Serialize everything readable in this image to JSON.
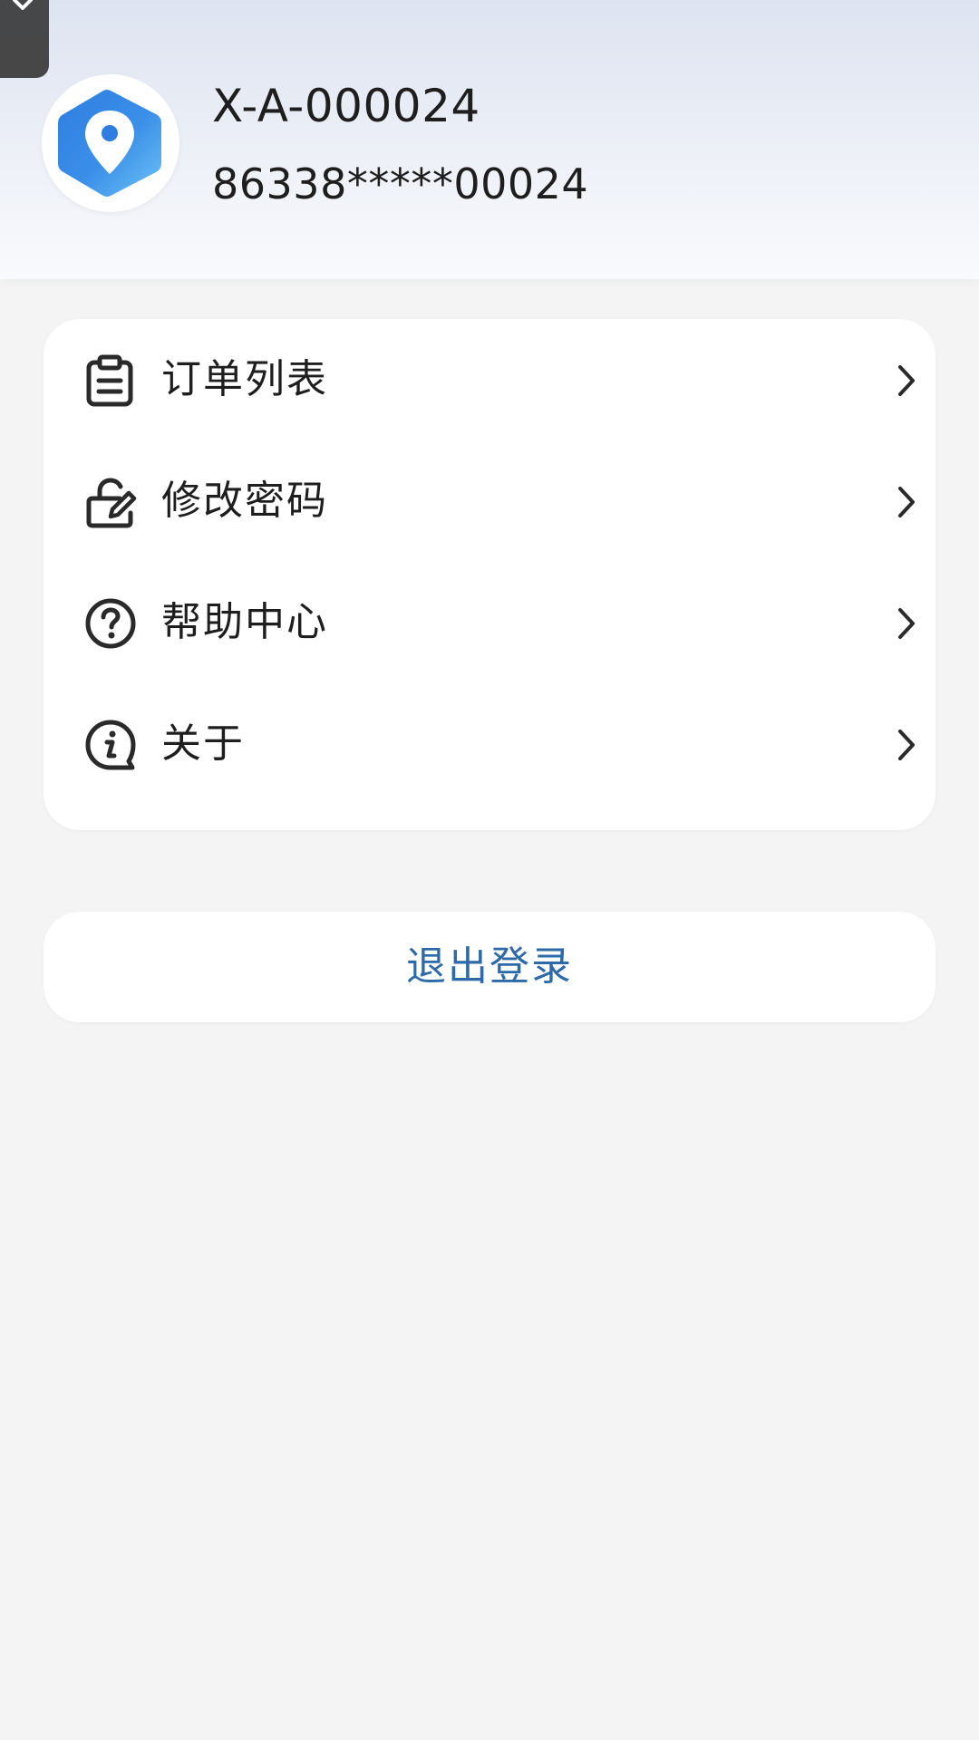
{
  "profile": {
    "name": "X-A-000024",
    "phone": "86338*****00024",
    "avatar_icon": "location-pin-hexagon-icon"
  },
  "menu": {
    "items": [
      {
        "label": "订单列表",
        "icon": "clipboard-list-icon"
      },
      {
        "label": "修改密码",
        "icon": "lock-edit-icon"
      },
      {
        "label": "帮助中心",
        "icon": "help-circle-icon"
      },
      {
        "label": "关于",
        "icon": "info-bubble-icon"
      }
    ]
  },
  "logout": {
    "label": "退出登录"
  },
  "colors": {
    "accent": "#2e6aa7",
    "background": "#f4f4f4",
    "card": "#ffffff",
    "text": "#1e1e1e",
    "avatar_blue": "#3b8fe8"
  }
}
